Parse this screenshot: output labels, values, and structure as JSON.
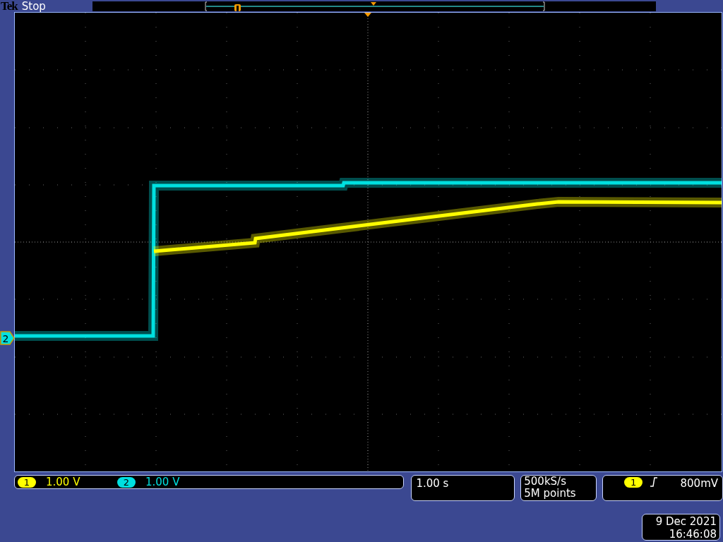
{
  "header": {
    "brand": "Tek",
    "status": "Stop"
  },
  "channel_marker": {
    "label": "2",
    "color": "#00e0e0"
  },
  "channels": [
    {
      "number": "1",
      "scale": "1.00 V",
      "color": "#ffff00"
    },
    {
      "number": "2",
      "scale": "1.00 V",
      "color": "#00e0e0"
    }
  ],
  "timebase": "1.00 s",
  "acquisition": {
    "rate": "500kS/s",
    "length": "5M points"
  },
  "trigger": {
    "source": "1",
    "level": "800mV",
    "color": "#ffff00"
  },
  "datetime": {
    "date": "9 Dec 2021",
    "time": "16:46:08"
  }
}
